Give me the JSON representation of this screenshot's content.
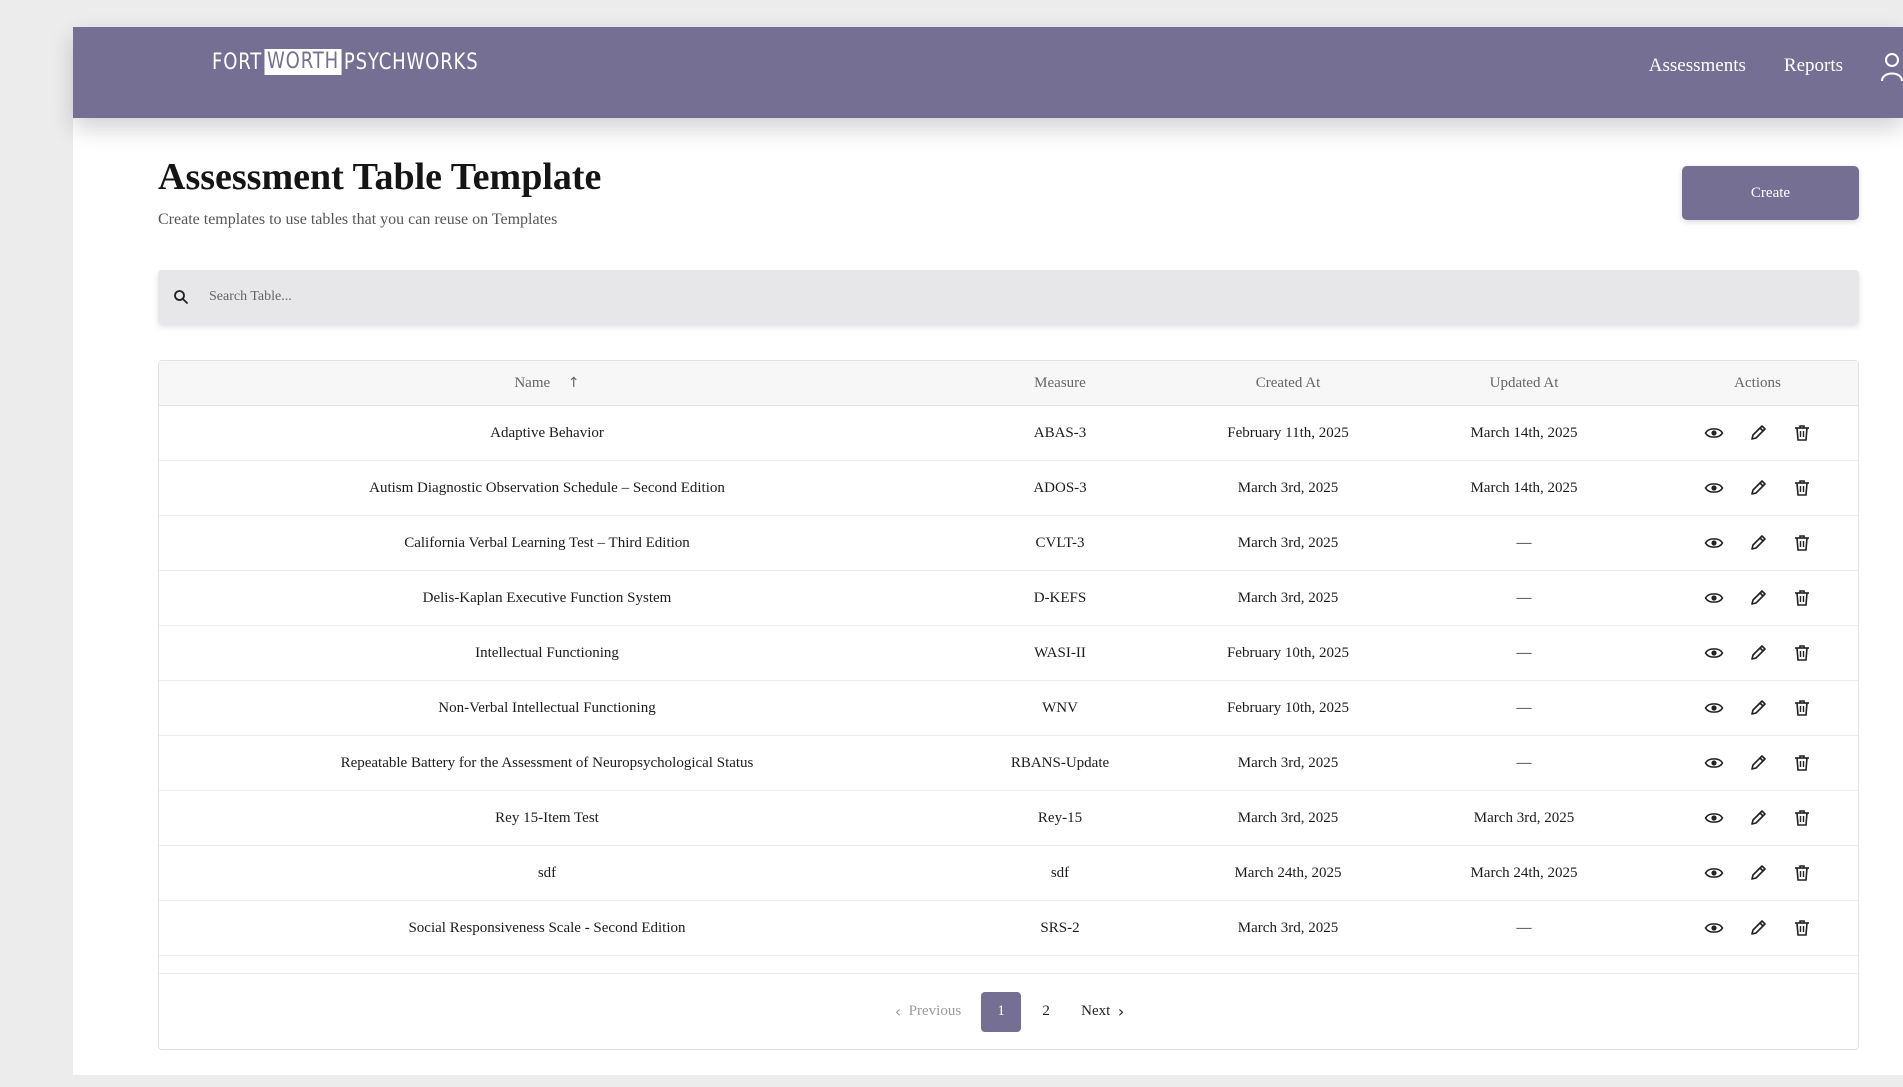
{
  "brand": {
    "logo_part1": "FORT",
    "logo_part2": "WORTH",
    "logo_part3": "PSYCHWORKS"
  },
  "nav": {
    "assessments": "Assessments",
    "reports": "Reports"
  },
  "header": {
    "title": "Assessment Table Template",
    "subtitle": "Create templates to use tables that you can reuse on Templates",
    "create_label": "Create"
  },
  "search": {
    "placeholder": "Search Table..."
  },
  "table": {
    "columns": {
      "name": "Name",
      "measure": "Measure",
      "created": "Created At",
      "updated": "Updated At",
      "actions": "Actions"
    },
    "sort_indicator": "↑",
    "rows": [
      {
        "name": "Adaptive Behavior",
        "measure": "ABAS-3",
        "created": "February 11th, 2025",
        "updated": "March 14th, 2025"
      },
      {
        "name": "Autism Diagnostic Observation Schedule – Second Edition",
        "measure": "ADOS-3",
        "created": "March 3rd, 2025",
        "updated": "March 14th, 2025"
      },
      {
        "name": "California Verbal Learning Test – Third Edition",
        "measure": "CVLT-3",
        "created": "March 3rd, 2025",
        "updated": "—"
      },
      {
        "name": "Delis-Kaplan Executive Function System",
        "measure": "D-KEFS",
        "created": "March 3rd, 2025",
        "updated": "—"
      },
      {
        "name": "Intellectual Functioning",
        "measure": "WASI-II",
        "created": "February 10th, 2025",
        "updated": "—"
      },
      {
        "name": "Non-Verbal Intellectual Functioning",
        "measure": "WNV",
        "created": "February 10th, 2025",
        "updated": "—"
      },
      {
        "name": "Repeatable Battery for the Assessment of Neuropsychological Status",
        "measure": "RBANS-Update",
        "created": "March 3rd, 2025",
        "updated": "—"
      },
      {
        "name": "Rey 15-Item Test",
        "measure": "Rey-15",
        "created": "March 3rd, 2025",
        "updated": "March 3rd, 2025"
      },
      {
        "name": "sdf",
        "measure": "sdf",
        "created": "March 24th, 2025",
        "updated": "March 24th, 2025"
      },
      {
        "name": "Social Responsiveness Scale - Second Edition",
        "measure": "SRS-2",
        "created": "March 3rd, 2025",
        "updated": "—"
      }
    ]
  },
  "pagination": {
    "previous": "Previous",
    "pages": [
      "1",
      "2"
    ],
    "current": "1",
    "next": "Next"
  },
  "colors": {
    "brand": "#757093",
    "page_bg": "#ececec",
    "search_bg": "#e7e7e9"
  },
  "icons": [
    "search-icon",
    "user-icon",
    "eye-icon",
    "pencil-icon",
    "trash-icon",
    "chevron-left-icon",
    "chevron-right-icon"
  ]
}
